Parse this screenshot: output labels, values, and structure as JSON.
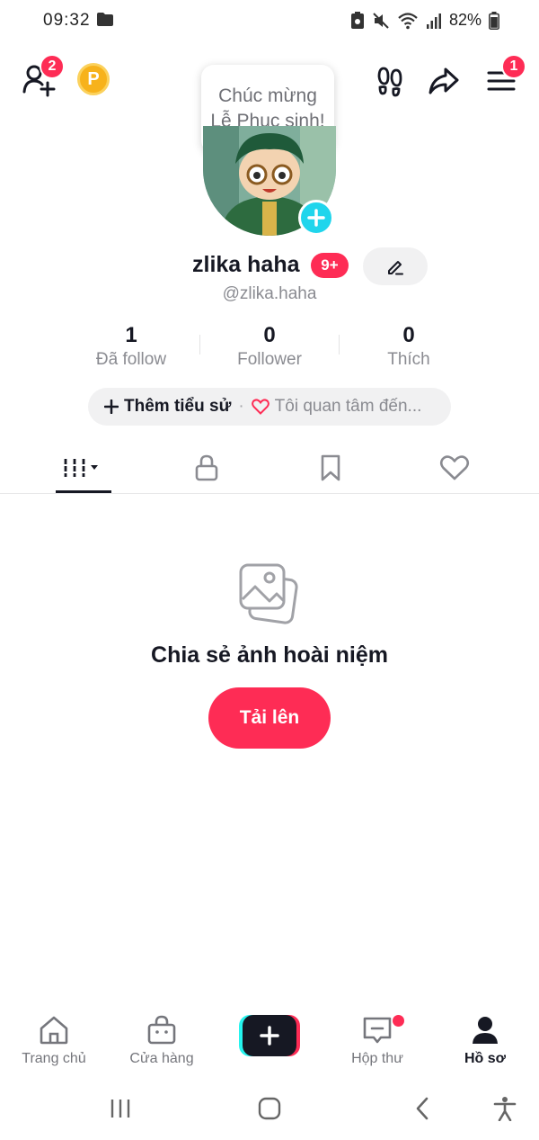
{
  "status_bar": {
    "time": "09:32",
    "battery": "82%"
  },
  "top_bar": {
    "add_friend_badge": "2",
    "coin_label": "P",
    "menu_badge": "1"
  },
  "profile": {
    "bubble_text": "Chúc mừng Lễ Phục sinh!",
    "display_name": "zlika haha",
    "name_badge": "9+",
    "username": "@zlika.haha"
  },
  "stats": [
    {
      "value": "1",
      "label": "Đã follow"
    },
    {
      "value": "0",
      "label": "Follower"
    },
    {
      "value": "0",
      "label": "Thích"
    }
  ],
  "bio": {
    "add_label": "Thêm tiểu sử",
    "separator": "·",
    "interest_label": "Tôi quan tâm đến..."
  },
  "empty_state": {
    "title": "Chia sẻ ảnh hoài niệm",
    "upload_label": "Tải lên"
  },
  "bottom_nav": {
    "items": [
      {
        "label": "Trang chủ",
        "icon": "home-icon"
      },
      {
        "label": "Cửa hàng",
        "icon": "shop-icon"
      },
      {
        "label": "Hộp thư",
        "icon": "inbox-icon"
      },
      {
        "label": "Hồ sơ",
        "icon": "profile-icon"
      }
    ]
  },
  "colors": {
    "accent": "#fe2c55",
    "cyan": "#20d5ec",
    "coin": "#f7b21b"
  }
}
